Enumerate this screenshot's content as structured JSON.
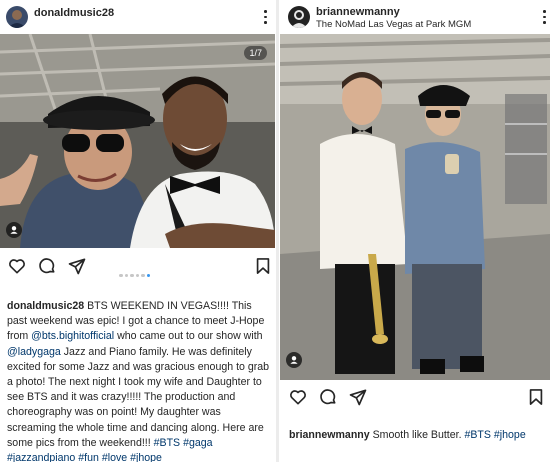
{
  "left_post": {
    "username": "donaldmusic28",
    "counter": "1/7",
    "caption_user": "donaldmusic28",
    "caption_parts": [
      {
        "t": " BTS WEEKEND IN VEGAS!!!! This past weekend was epic! I got a chance to meet J-Hope from ",
        "link": false
      },
      {
        "t": "@bts.bighitofficial",
        "link": true
      },
      {
        "t": " who came out to our show with ",
        "link": false
      },
      {
        "t": "@ladygaga",
        "link": true
      },
      {
        "t": " Jazz and Piano family. He was definitely excited for some Jazz and was gracious enough to grab a photo! The next night I took my wife and Daughter to see BTS and it was crazy!!!!! The production and choreography was on point! My daughter was screaming the whole time and dancing along. Here are some pics from the weekend!!! ",
        "link": false
      },
      {
        "t": "#BTS #gaga #jazzandpiano #fun #love #jhope",
        "link": true
      }
    ],
    "carousel_dots": 6,
    "carousel_active": 5
  },
  "right_post": {
    "username": "briannewmanny",
    "location": "The NoMad Las Vegas at Park MGM",
    "caption_user": "briannewmanny",
    "caption_parts": [
      {
        "t": " Smooth like Butter. ",
        "link": false
      },
      {
        "t": "#BTS #jhope",
        "link": true
      }
    ]
  },
  "icons": {
    "like": "heart-icon",
    "comment": "comment-icon",
    "share": "send-icon",
    "save": "bookmark-icon",
    "more": "more-options-icon",
    "tag": "user-tag-icon"
  },
  "colors": {
    "text": "#262626",
    "link": "#00376b",
    "carousel_active": "#3897f0"
  }
}
